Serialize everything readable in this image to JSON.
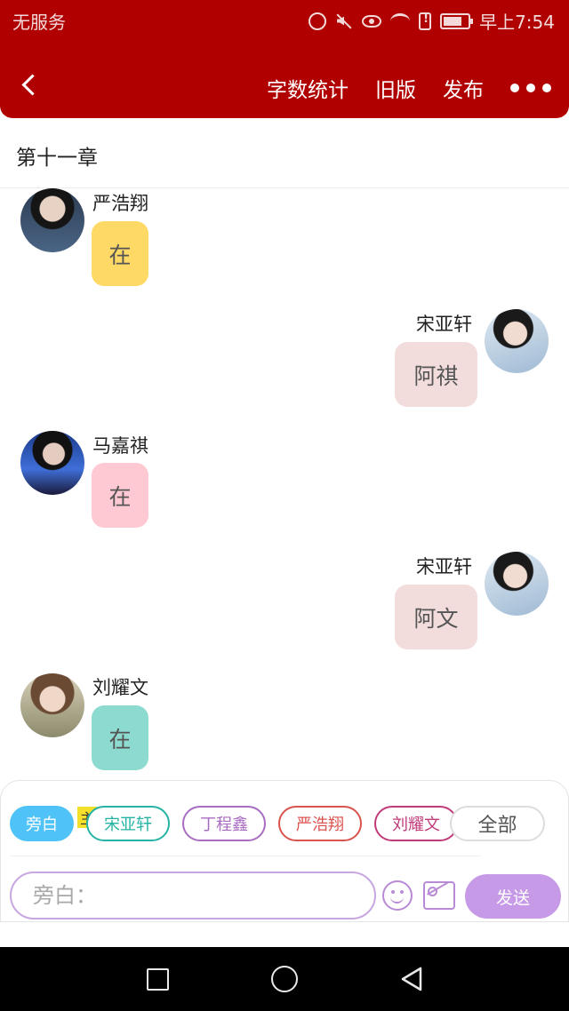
{
  "status_bar": {
    "carrier": "无服务",
    "time": "早上7:54"
  },
  "header": {
    "back_icon": "chevron-left-icon",
    "actions": [
      "字数统计",
      "旧版",
      "发布"
    ],
    "more_icon": "more-dots-icon",
    "bg_color": "#b00000"
  },
  "chapter_title": "第十一章",
  "messages": [
    {
      "side": "left",
      "name": "严浩翔",
      "text": "在",
      "bubble_color": "#ffd966"
    },
    {
      "side": "right",
      "name": "宋亚轩",
      "text": "阿祺",
      "bubble_color": "#f2dcdc"
    },
    {
      "side": "left",
      "name": "马嘉祺",
      "text": "在",
      "bubble_color": "#ffc9d4"
    },
    {
      "side": "right",
      "name": "宋亚轩",
      "text": "阿文",
      "bubble_color": "#f2dcdc"
    },
    {
      "side": "left",
      "name": "刘耀文",
      "text": "在",
      "bubble_color": "#8ddbd0"
    }
  ],
  "composer": {
    "host_badge": "主",
    "chips": [
      {
        "label": "旁白",
        "color": "#4fc3f7"
      },
      {
        "label": "宋亚轩",
        "color": "#26b3a3"
      },
      {
        "label": "丁程鑫",
        "color": "#a86cc1"
      },
      {
        "label": "严浩翔",
        "color": "#d9534f"
      },
      {
        "label": "刘耀文",
        "color": "#c13b7a"
      },
      {
        "label": "全部",
        "color": "#999999"
      }
    ],
    "input_placeholder": "旁白：",
    "emoji_icon": "smiley-icon",
    "image_icon": "image-icon",
    "send_label": "发送",
    "accent_color": "#c69ae6"
  },
  "android_nav": {
    "icons": [
      "recents-square-icon",
      "home-circle-icon",
      "back-triangle-icon"
    ]
  }
}
